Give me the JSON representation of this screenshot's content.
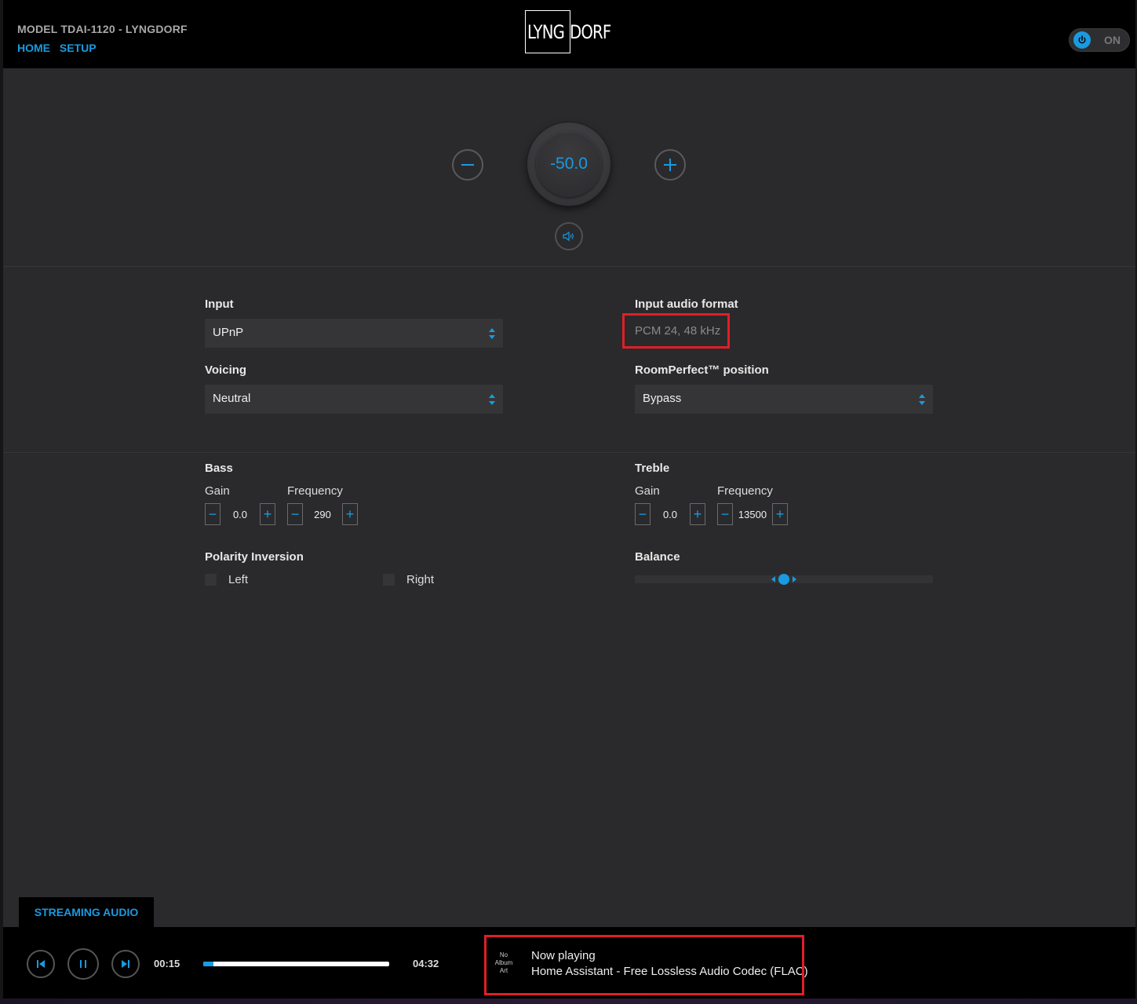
{
  "header": {
    "model": "MODEL TDAI-1120 - LYNGDORF",
    "nav": {
      "home": "HOME",
      "setup": "SETUP"
    },
    "logo_boxed": "LYNG",
    "logo_rest": "DORF",
    "power_label": "ON"
  },
  "volume": {
    "value": "-50.0",
    "decrease_icon": "minus-icon",
    "increase_icon": "plus-icon",
    "mute_icon": "speaker-icon"
  },
  "settings": {
    "input_label": "Input",
    "input_value": "UPnP",
    "format_label": "Input audio format",
    "format_value": "PCM 24, 48 kHz",
    "voicing_label": "Voicing",
    "voicing_value": "Neutral",
    "roomperfect_label": "RoomPerfect™ position",
    "roomperfect_value": "Bypass"
  },
  "tone": {
    "bass_label": "Bass",
    "treble_label": "Treble",
    "gain_label": "Gain",
    "frequency_label": "Frequency",
    "bass_gain": "0.0",
    "bass_frequency": "290",
    "treble_gain": "0.0",
    "treble_frequency": "13500",
    "minus": "−",
    "plus": "+"
  },
  "polarity": {
    "label": "Polarity Inversion",
    "left": "Left",
    "right": "Right"
  },
  "balance": {
    "label": "Balance",
    "position": 0.5
  },
  "player": {
    "tab_label": "STREAMING AUDIO",
    "elapsed": "00:15",
    "duration": "04:32",
    "progress": 0.055,
    "album_art": [
      "No",
      "Album",
      "Art"
    ],
    "now_playing_label": "Now playing",
    "track": "Home Assistant - Free Lossless Audio Codec (FLAC)"
  },
  "colors": {
    "accent": "#1a9ae0",
    "highlight": "#e01f26",
    "background": "#2a2a2c"
  }
}
